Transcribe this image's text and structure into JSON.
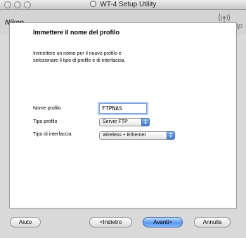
{
  "window": {
    "title": "WT-4 Setup Utility"
  },
  "header": {
    "brand": "Nikon.",
    "setup_label": "Setup"
  },
  "page": {
    "heading": "Immettere il nome del profilo",
    "description_line1": "Immettere un nome per il nuovo profilo e",
    "description_line2": "selezionare il tipo di profilo e di interfaccia."
  },
  "form": {
    "profile_name_label": "Nome profilo",
    "profile_name_value": "FTPNAS",
    "profile_type_label": "Tipo profilo",
    "profile_type_value": "Server FTP",
    "interface_label": "Tipo di interfaccia",
    "interface_value": "Wireless + Ethernet"
  },
  "buttons": {
    "help": "Aiuto",
    "back": "<Indietro",
    "next": "Avanti>",
    "cancel": "Annulla"
  },
  "icons": {
    "window": "wt4-app-icon",
    "setup": "wireless-signal-icon",
    "select_arrows": "up-down-arrows-icon"
  },
  "colors": {
    "window_bg": "#d9d9d9",
    "panel_bg": "#ffffff",
    "default_button_blue": "#5a9af0",
    "focus_ring": "#b5cff2"
  }
}
